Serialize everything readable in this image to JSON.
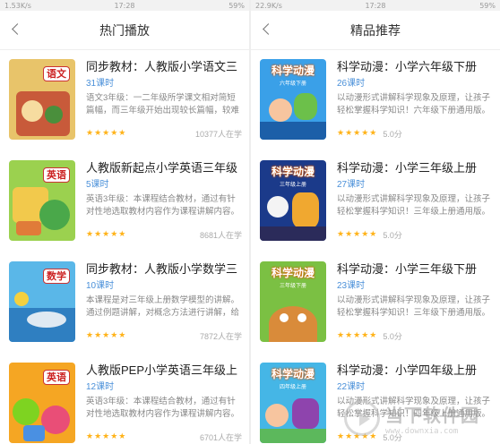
{
  "left": {
    "status": {
      "carrier": "1.53K/s",
      "time": "17:28",
      "battery": "59%"
    },
    "title": "热门播放",
    "items": [
      {
        "title": "同步教材：人教版小学语文三",
        "count": "31课时",
        "desc": "语文3年级：一二年级所学课文相对简短篇幅，而三年级开始出现较长篇幅，较难",
        "learners": "10377人在学",
        "stars": "★★★★★",
        "cover": {
          "badge": "语文",
          "bg": "#e8c46a",
          "accent": "#c85a3a"
        }
      },
      {
        "title": "人教版新起点小学英语三年级",
        "count": "5课时",
        "desc": "英语3年级：本课程结合教材，通过有针对性地选取教材内容作为课程讲解内容。",
        "learners": "8681人在学",
        "stars": "★★★★★",
        "cover": {
          "badge": "英语",
          "bg": "#9bd14f",
          "accent": "#f2c94c"
        }
      },
      {
        "title": "同步教材：人教版小学数学三",
        "count": "10课时",
        "desc": "本课程是对三年级上册数学模型的讲解。通过例题讲解，对概念方法进行讲解，给",
        "learners": "7872人在学",
        "stars": "★★★★★",
        "cover": {
          "badge": "数学",
          "bg": "#5ab7e8",
          "accent": "#f4d03f"
        }
      },
      {
        "title": "人教版PEP小学英语三年级上",
        "count": "12课时",
        "desc": "英语3年级：本课程结合教材，通过有针对性地选取教材内容作为课程讲解内容。",
        "learners": "6701人在学",
        "stars": "★★★★★",
        "cover": {
          "badge": "英语",
          "bg": "#f5a623",
          "accent": "#7ed321"
        }
      }
    ]
  },
  "right": {
    "status": {
      "carrier": "22.9K/s",
      "time": "17:28",
      "battery": "59%"
    },
    "title": "精品推荐",
    "items": [
      {
        "title": "科学动漫：小学六年级下册",
        "count": "26课时",
        "desc": "以动漫形式讲解科学现象及原理，让孩子轻松掌握科学知识！六年级下册通用版。",
        "score": "5.0分",
        "stars": "★★★★★",
        "cover": {
          "logo": "科学动漫",
          "sub": "六年级下册",
          "bg": "#3aa0e8"
        }
      },
      {
        "title": "科学动漫：小学三年级上册",
        "count": "27课时",
        "desc": "以动漫形式讲解科学现象及原理，让孩子轻松掌握科学知识！三年级上册通用版。",
        "score": "5.0分",
        "stars": "★★★★★",
        "cover": {
          "logo": "科学动漫",
          "sub": "三年级上册",
          "bg": "#1b3a8a"
        }
      },
      {
        "title": "科学动漫：小学三年级下册",
        "count": "23课时",
        "desc": "以动漫形式讲解科学现象及原理，让孩子轻松掌握科学知识！三年级下册通用版。",
        "score": "5.0分",
        "stars": "★★★★★",
        "cover": {
          "logo": "科学动漫",
          "sub": "三年级下册",
          "bg": "#7bc043"
        }
      },
      {
        "title": "科学动漫：小学四年级上册",
        "count": "22课时",
        "desc": "以动漫形式讲解科学现象及原理，让孩子轻松掌握科学知识！四年级上册通用版。",
        "score": "5.0分",
        "stars": "★★★★★",
        "cover": {
          "logo": "科学动漫",
          "sub": "四年级上册",
          "bg": "#45b6e6"
        }
      }
    ]
  },
  "watermark": {
    "name": "当下软件园",
    "url": "www.downxia.com"
  }
}
